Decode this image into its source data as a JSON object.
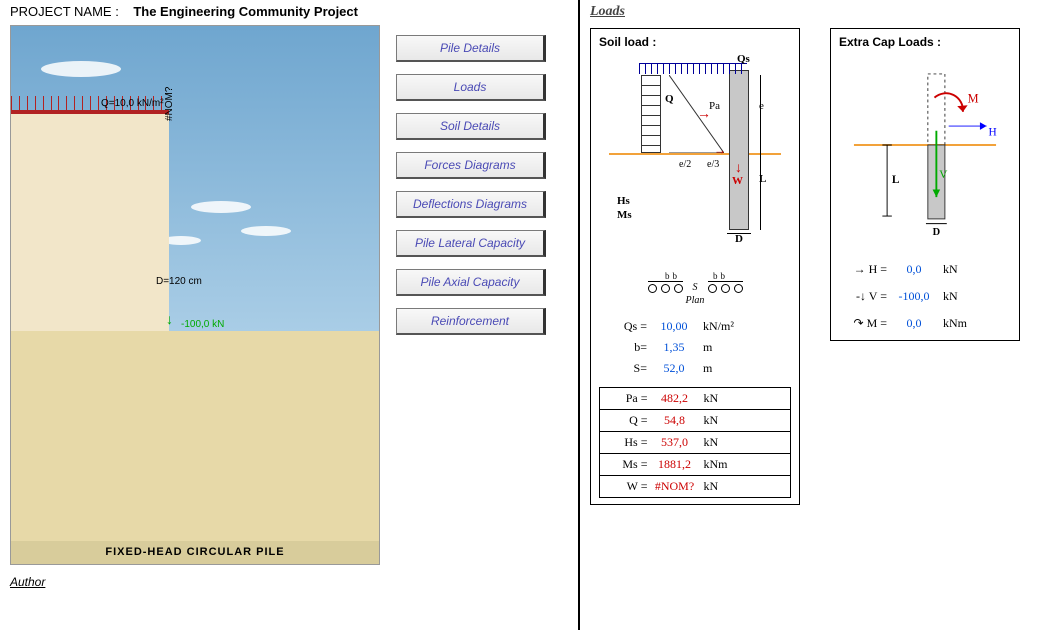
{
  "project": {
    "label": "PROJECT NAME :",
    "name": "The Engineering Community Project",
    "author_label": "Author"
  },
  "buttons": {
    "pile_details": "Pile Details",
    "loads": "Loads",
    "soil_details": "Soil Details",
    "forces_diagrams": "Forces Diagrams",
    "deflections_diagrams": "Deflections Diagrams",
    "pile_lateral_capacity": "Pile Lateral Capacity",
    "pile_axial_capacity": "Pile Axial Capacity",
    "reinforcement": "Reinforcement"
  },
  "illustration": {
    "q_label": "Q=10,0 kN/m²",
    "nom_vert": "#NOM?",
    "d_label": "D=120 cm",
    "v_load": "-100,0 kN",
    "caption": "FIXED-HEAD  CIRCULAR  PILE"
  },
  "loads_section": {
    "title": "Loads",
    "soil_panel_title": "Soil load :",
    "extra_panel_title": "Extra Cap Loads :",
    "diagram_labels": {
      "Qs": "Qs",
      "Q": "Q",
      "Pa": "Pa",
      "e": "e",
      "e12": "e/2",
      "e13": "e/3",
      "W": "W",
      "L": "L",
      "D": "D",
      "Hs": "Hs",
      "Ms": "Ms",
      "Plan": "Plan",
      "S": "S",
      "b": "b",
      "M": "M",
      "H": "H",
      "V": "V"
    },
    "soil_inputs": [
      {
        "sym": "Qs =",
        "val": "10,00",
        "unit": "kN/m²",
        "cls": "blue"
      },
      {
        "sym": "b=",
        "val": "1,35",
        "unit": "m",
        "cls": "blue"
      },
      {
        "sym": "S=",
        "val": "52,0",
        "unit": "m",
        "cls": "blue"
      }
    ],
    "soil_results": [
      {
        "sym": "Pa =",
        "val": "482,2",
        "unit": "kN",
        "cls": "red"
      },
      {
        "sym": "Q =",
        "val": "54,8",
        "unit": "kN",
        "cls": "red"
      },
      {
        "sym": "Hs =",
        "val": "537,0",
        "unit": "kN",
        "cls": "red"
      },
      {
        "sym": "Ms =",
        "val": "1881,2",
        "unit": "kNm",
        "cls": "red"
      },
      {
        "sym": "W =",
        "val": "#NOM?",
        "unit": "kN",
        "cls": "red"
      }
    ],
    "extra_values": [
      {
        "icon": "→",
        "sym": "H =",
        "val": "0,0",
        "unit": "kN",
        "cls": "blue"
      },
      {
        "icon": "-↓",
        "sym": "V =",
        "val": "-100,0",
        "unit": "kN",
        "cls": "blue"
      },
      {
        "icon": "↷",
        "sym": "M =",
        "val": "0,0",
        "unit": "kNm",
        "cls": "blue"
      }
    ]
  }
}
